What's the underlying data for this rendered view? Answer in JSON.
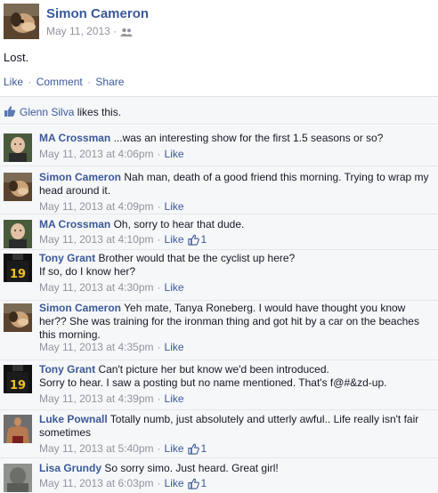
{
  "post": {
    "author": "Simon Cameron",
    "date": "May 11, 2013 ·",
    "text": "Lost.",
    "actions": {
      "like": "Like",
      "comment": "Comment",
      "share": "Share",
      "sep": "·"
    }
  },
  "likes": {
    "name": "Glenn Silva",
    "suffix": " likes this."
  },
  "comments": [
    {
      "author": "MA Crossman",
      "text": " ...was an interesting show for the first 1.5 seasons or so?",
      "time": "May 11, 2013 at 4:06pm",
      "like": "Like",
      "count": ""
    },
    {
      "author": "Simon Cameron",
      "text": " Nah man, death of a good friend this morning. Trying to wrap my head around it.",
      "time": "May 11, 2013 at 4:09pm",
      "like": "Like",
      "count": ""
    },
    {
      "author": "MA Crossman",
      "text": " Oh, sorry to hear that dude.",
      "time": "May 11, 2013 at 4:10pm",
      "like": "Like",
      "count": "1"
    },
    {
      "author": "Tony Grant",
      "text": " Brother would that be the cyclist up here?\nIf so, do I know her?",
      "time": "May 11, 2013 at 4:30pm",
      "like": "Like",
      "count": ""
    },
    {
      "author": "Simon Cameron",
      "text": " Yeh mate, Tanya Roneberg. I would have thought you know her?? She was training for the ironman thing and got hit by a car on the beaches this morning.",
      "time": "May 11, 2013 at 4:35pm",
      "like": "Like",
      "count": ""
    },
    {
      "author": "Tony Grant",
      "text": " Can't picture her but know we'd been introduced.\nSorry to hear. I saw a posting but no name mentioned. That's f@#&zd-up.",
      "time": "May 11, 2013 at 4:39pm",
      "like": "Like",
      "count": ""
    },
    {
      "author": "Luke Pownall",
      "text": " Totally numb, just absolutely and utterly awful.. Life really isn't fair sometimes",
      "time": "May 11, 2013 at 5:40pm",
      "like": "Like",
      "count": "1"
    },
    {
      "author": "Lisa Grundy",
      "text": " So sorry simo. Just heard. Great girl!",
      "time": "May 11, 2013 at 6:03pm",
      "like": "Like",
      "count": "1"
    }
  ],
  "colors": {
    "link": "#3b5998",
    "meta": "#90949c",
    "panel": "#f6f7f9"
  }
}
